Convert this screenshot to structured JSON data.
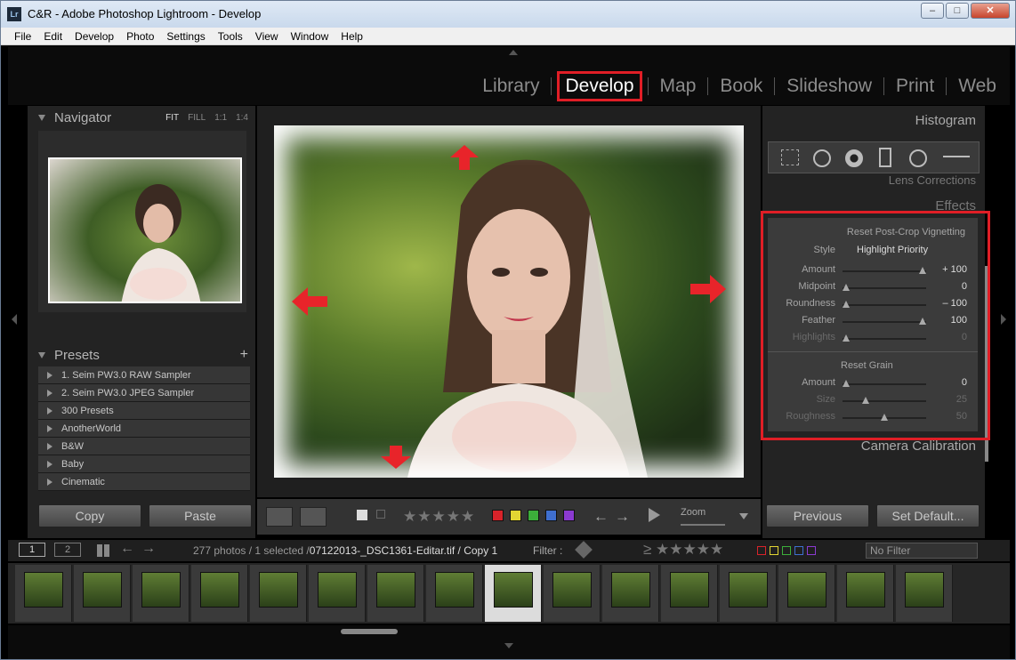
{
  "window": {
    "title": "C&R - Adobe Photoshop Lightroom - Develop",
    "app_icon": "Lr"
  },
  "menu": [
    "File",
    "Edit",
    "Develop",
    "Photo",
    "Settings",
    "Tools",
    "View",
    "Window",
    "Help"
  ],
  "modules": [
    "Library",
    "Develop",
    "Map",
    "Book",
    "Slideshow",
    "Print",
    "Web"
  ],
  "navigator": {
    "title": "Navigator",
    "options": [
      "FIT",
      "FILL",
      "1:1",
      "1:4"
    ]
  },
  "presets": {
    "title": "Presets",
    "items": [
      "1. Seim PW3.0 RAW Sampler",
      "2. Seim PW3.0 JPEG Sampler",
      "300 Presets",
      "AnotherWorld",
      "B&W",
      "Baby",
      "Cinematic"
    ]
  },
  "left_buttons": {
    "copy": "Copy",
    "paste": "Paste"
  },
  "right_panel": {
    "histogram": "Histogram",
    "lens": "Lens Corrections",
    "effects": "Effects",
    "camera": "Camera Calibration"
  },
  "vignette": {
    "header": "Reset Post-Crop Vignetting",
    "style_label": "Style",
    "style_value": "Highlight Priority",
    "rows": [
      {
        "label": "Amount",
        "value": "+ 100"
      },
      {
        "label": "Midpoint",
        "value": "0"
      },
      {
        "label": "Roundness",
        "value": "– 100"
      },
      {
        "label": "Feather",
        "value": "100"
      },
      {
        "label": "Highlights",
        "value": "0"
      }
    ],
    "slider_levels": [
      1.0,
      0.0,
      0.0,
      1.0,
      0.0
    ],
    "grain_header": "Reset Grain",
    "grain_rows": [
      {
        "label": "Amount",
        "value": "0"
      },
      {
        "label": "Size",
        "value": "25"
      },
      {
        "label": "Roughness",
        "value": "50"
      }
    ],
    "grain_levels": [
      0.0,
      0.25,
      0.5
    ]
  },
  "right_buttons": {
    "previous": "Previous",
    "set_default": "Set Default..."
  },
  "toolbar": {
    "zoom_label": "Zoom",
    "stars": "★★★★★",
    "swatch_colors": [
      "#d8232a",
      "#e2d533",
      "#3cae3a",
      "#3f6fcf",
      "#8b3ad1"
    ]
  },
  "filmstrip_bar": {
    "count_text": "277 photos / 1 selected /",
    "file_name": "07122013-_DSC1361-Editar.tif / Copy 1",
    "filter_label": "Filter :",
    "no_filter": "No Filter",
    "page1": "1",
    "page2": "2",
    "stars": "≥ ★★★★★"
  },
  "filmstrip": {
    "count": 16,
    "selected_index": 7
  }
}
